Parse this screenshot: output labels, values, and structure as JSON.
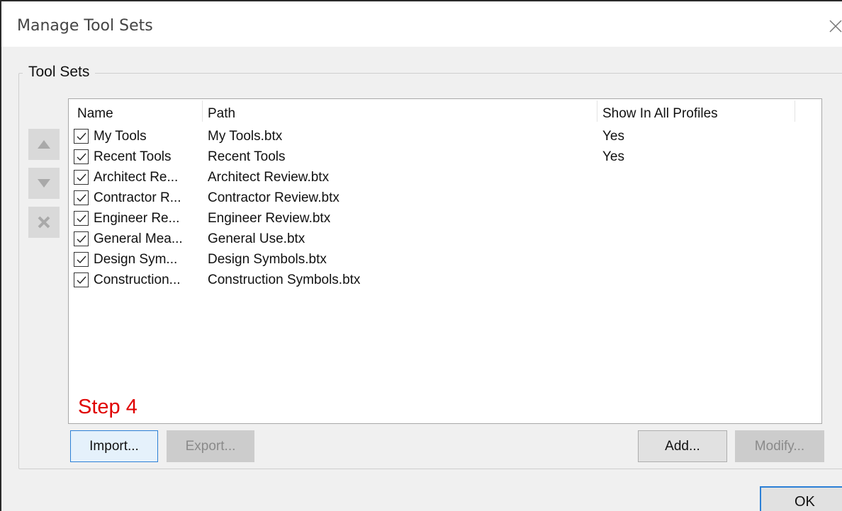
{
  "window": {
    "title": "Manage Tool Sets"
  },
  "group": {
    "label": "Tool Sets"
  },
  "side_buttons": [
    {
      "name": "move-up-button",
      "icon": "up-triangle-icon"
    },
    {
      "name": "move-down-button",
      "icon": "down-triangle-icon"
    },
    {
      "name": "delete-button",
      "icon": "x-icon"
    }
  ],
  "list": {
    "columns": [
      "Name",
      "Path",
      "Show In All Profiles"
    ],
    "rows": [
      {
        "checked": true,
        "name": "My Tools",
        "path": "My Tools.btx",
        "show_all": "Yes"
      },
      {
        "checked": true,
        "name": "Recent Tools",
        "path": "Recent Tools",
        "show_all": "Yes"
      },
      {
        "checked": true,
        "name": "Architect Re...",
        "path": "Architect Review.btx",
        "show_all": ""
      },
      {
        "checked": true,
        "name": "Contractor R...",
        "path": "Contractor Review.btx",
        "show_all": ""
      },
      {
        "checked": true,
        "name": "Engineer Re...",
        "path": "Engineer Review.btx",
        "show_all": ""
      },
      {
        "checked": true,
        "name": "General Mea...",
        "path": "General Use.btx",
        "show_all": ""
      },
      {
        "checked": true,
        "name": "Design Sym...",
        "path": "Design Symbols.btx",
        "show_all": ""
      },
      {
        "checked": true,
        "name": "Construction...",
        "path": "Construction Symbols.btx",
        "show_all": ""
      }
    ]
  },
  "annotation": {
    "step": "Step 4",
    "color": "#e00000"
  },
  "buttons": {
    "import": "Import...",
    "export": "Export...",
    "add": "Add...",
    "modify": "Modify...",
    "ok": "OK"
  },
  "colors": {
    "accent": "#2b7fd6",
    "disabled_text": "#8a8a8a"
  }
}
